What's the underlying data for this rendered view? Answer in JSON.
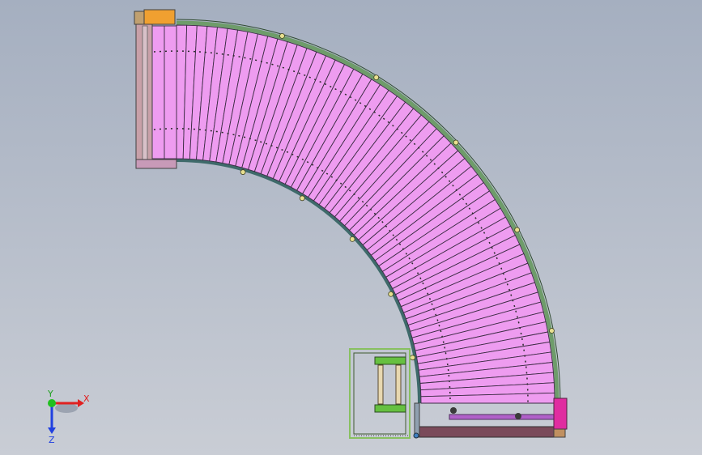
{
  "viewport": {
    "background_top": "#a5afc0",
    "background_bottom": "#c9cdd5"
  },
  "model": {
    "part": "curved-roller-conveyor-90deg",
    "roller_color": "#ee9cf0",
    "roller_outline": "#3c2c44",
    "outer_rail_color": "#6e9c6a",
    "inner_rail_color": "#3e6a6a",
    "drive_motor_color": "#e02ca0",
    "end_bracket_color": "#f0a030",
    "support_frame_color": "#88c060"
  },
  "triad": {
    "x_label": "X",
    "y_label": "Y",
    "z_label": "Z",
    "x_color": "#e02020",
    "y_color": "#20c020",
    "z_color": "#2040e0"
  }
}
